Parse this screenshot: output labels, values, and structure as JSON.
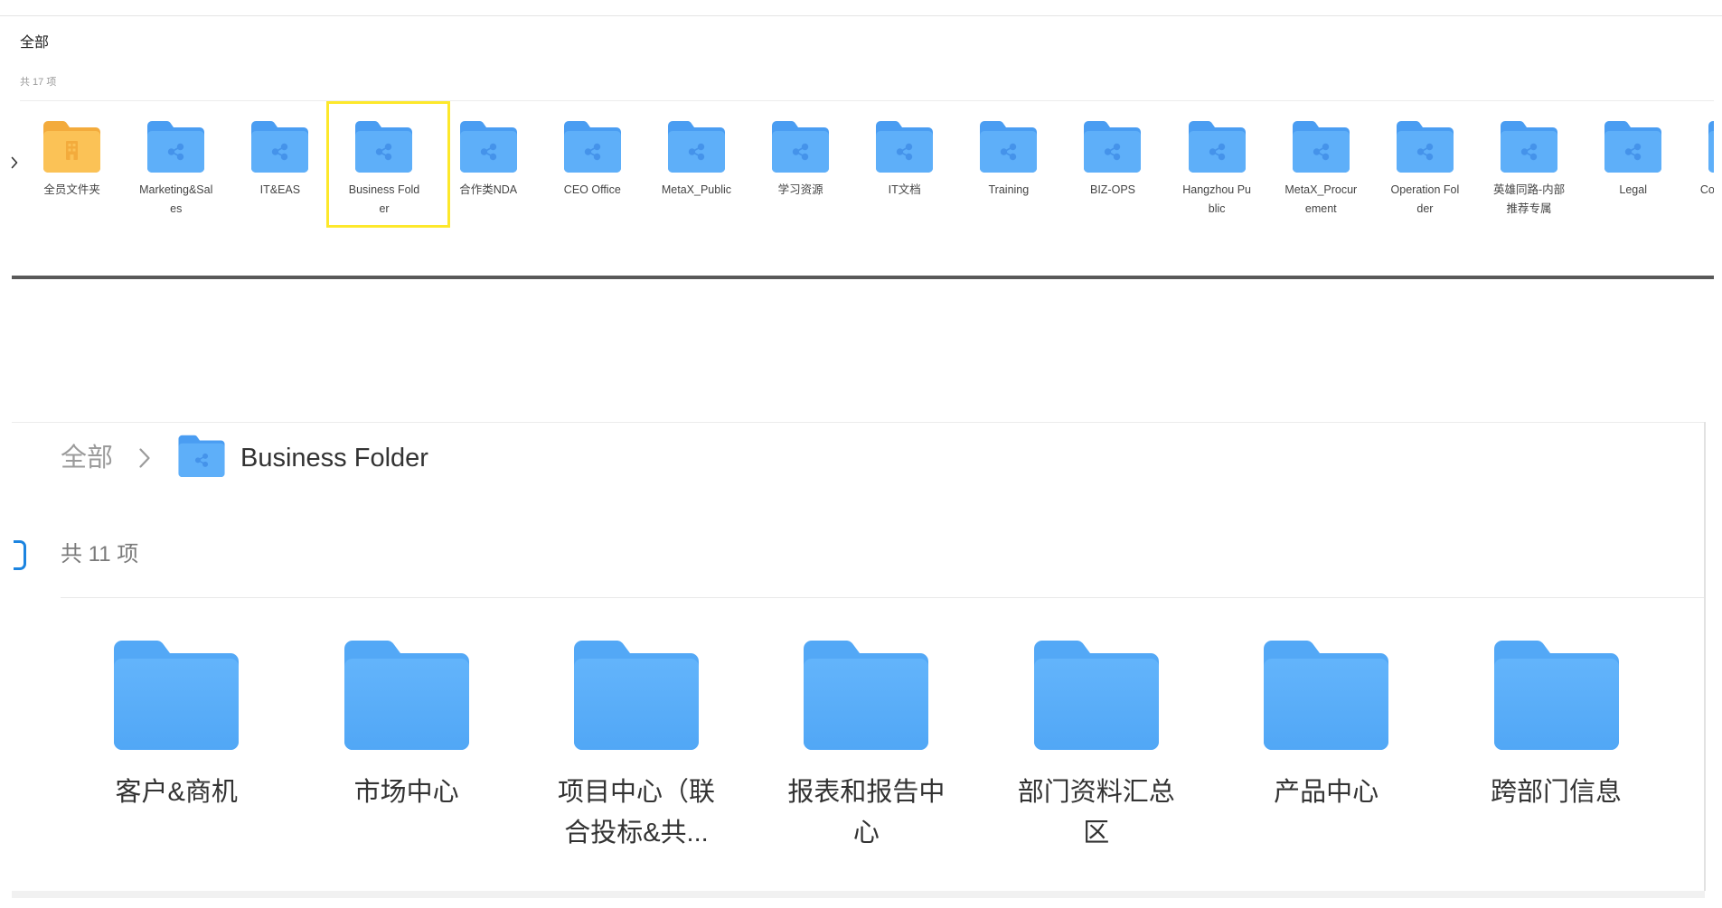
{
  "top_panel": {
    "title": "全部",
    "count": "共 17 项",
    "folders": [
      {
        "label": "全员文件夹",
        "icon": "building-folder-icon"
      },
      {
        "label": "Marketing&Sales",
        "icon": "shared-folder-icon"
      },
      {
        "label": "IT&EAS",
        "icon": "shared-folder-icon"
      },
      {
        "label": "Business Folder",
        "icon": "shared-folder-icon",
        "highlighted": true
      },
      {
        "label": "合作类NDA",
        "icon": "shared-folder-icon"
      },
      {
        "label": "CEO Office",
        "icon": "shared-folder-icon"
      },
      {
        "label": "MetaX_Public",
        "icon": "shared-folder-icon"
      },
      {
        "label": "学习资源",
        "icon": "shared-folder-icon"
      },
      {
        "label": "IT文档",
        "icon": "shared-folder-icon"
      },
      {
        "label": "Training",
        "icon": "shared-folder-icon"
      },
      {
        "label": "BIZ-OPS",
        "icon": "shared-folder-icon"
      },
      {
        "label": "Hangzhou Public",
        "icon": "shared-folder-icon"
      },
      {
        "label": "MetaX_Procurement",
        "icon": "shared-folder-icon"
      },
      {
        "label": "Operation Folder",
        "icon": "shared-folder-icon"
      },
      {
        "label": "英雄同路-内部推荐专属",
        "icon": "shared-folder-icon"
      },
      {
        "label": "Legal",
        "icon": "shared-folder-icon"
      },
      {
        "label": "Co",
        "icon": "shared-folder-icon"
      }
    ]
  },
  "breadcrumb": {
    "root": "全部",
    "separator_icon": "chevron-right-icon",
    "folder_icon": "shared-folder-icon",
    "current": "Business Folder"
  },
  "folder_view": {
    "count": "共 11 项",
    "folders": [
      {
        "label": "客户&商机",
        "icon": "folder-icon"
      },
      {
        "label": "市场中心",
        "icon": "folder-icon"
      },
      {
        "label": "项目中心（联合投标&共...",
        "icon": "folder-icon"
      },
      {
        "label": "报表和报告中心",
        "icon": "folder-icon"
      },
      {
        "label": "部门资料汇总区",
        "icon": "folder-icon"
      },
      {
        "label": "产品中心",
        "icon": "folder-icon"
      },
      {
        "label": "跨部门信息",
        "icon": "folder-icon"
      }
    ]
  },
  "colors": {
    "folder_blue": "#5eaff9",
    "folder_blue_dark": "#4a9df2",
    "share_glyph": "#4593ea",
    "folder_orange": "#fbc256",
    "folder_orange_dark": "#f3ab3c",
    "selection_highlight": "#fde82b",
    "accent": "#1c84e0"
  }
}
